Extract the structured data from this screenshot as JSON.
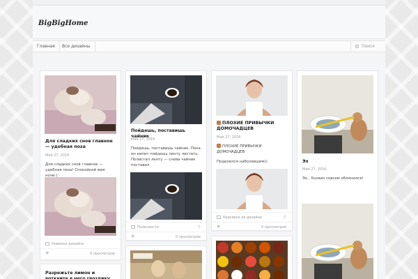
{
  "site": {
    "logo": "BigBigHome"
  },
  "nav": {
    "home": "Главная",
    "all_designs": "Все дизайны",
    "search_placeholder": "Поиск"
  },
  "cards": [
    {
      "title": "Для сладких снов главное — удобная поза",
      "date": "Май 27, 2016",
      "text": "Для сладких снов главное — удобная поза! Спокойной вам ночи:)",
      "category": "Новинки дизайна",
      "views": "0 просмотров"
    },
    {
      "title": "Пойдешь, поставишь чайник",
      "date": "Май 27, 2016",
      "text": "Пойдешь, поставишь чайник. Пока он кипит пойдешь ленту листать. Полистал ленту — снова чайник поставил.",
      "category": "Полезности",
      "views": "0 просмотров"
    },
    {
      "title": "ПЛОХИЕ ПРИВЫЧКИ ДОМОЧАДЦЕВ",
      "date": "Май 27, 2016",
      "text": "ПЛОХИЕ ПРИВЫЧКИ ДОМОЧАДЦЕВ",
      "text2": "Поделился наболевшим))",
      "category": "Красивое из дизайна",
      "views": "0 просмотров"
    },
    {
      "title": "Эх",
      "date": "Май 27, 2016",
      "text": "Эх.. Хозяин совсем обленился!"
    },
    {
      "title": "Разрежьте лимон и воткните в него гвоздику"
    }
  ],
  "colors": {
    "background": "#e9e9ea",
    "site_background": "#f4f5f7",
    "card_background": "#ffffff",
    "title": "#1a1a1a",
    "muted": "#9a9a9a"
  }
}
